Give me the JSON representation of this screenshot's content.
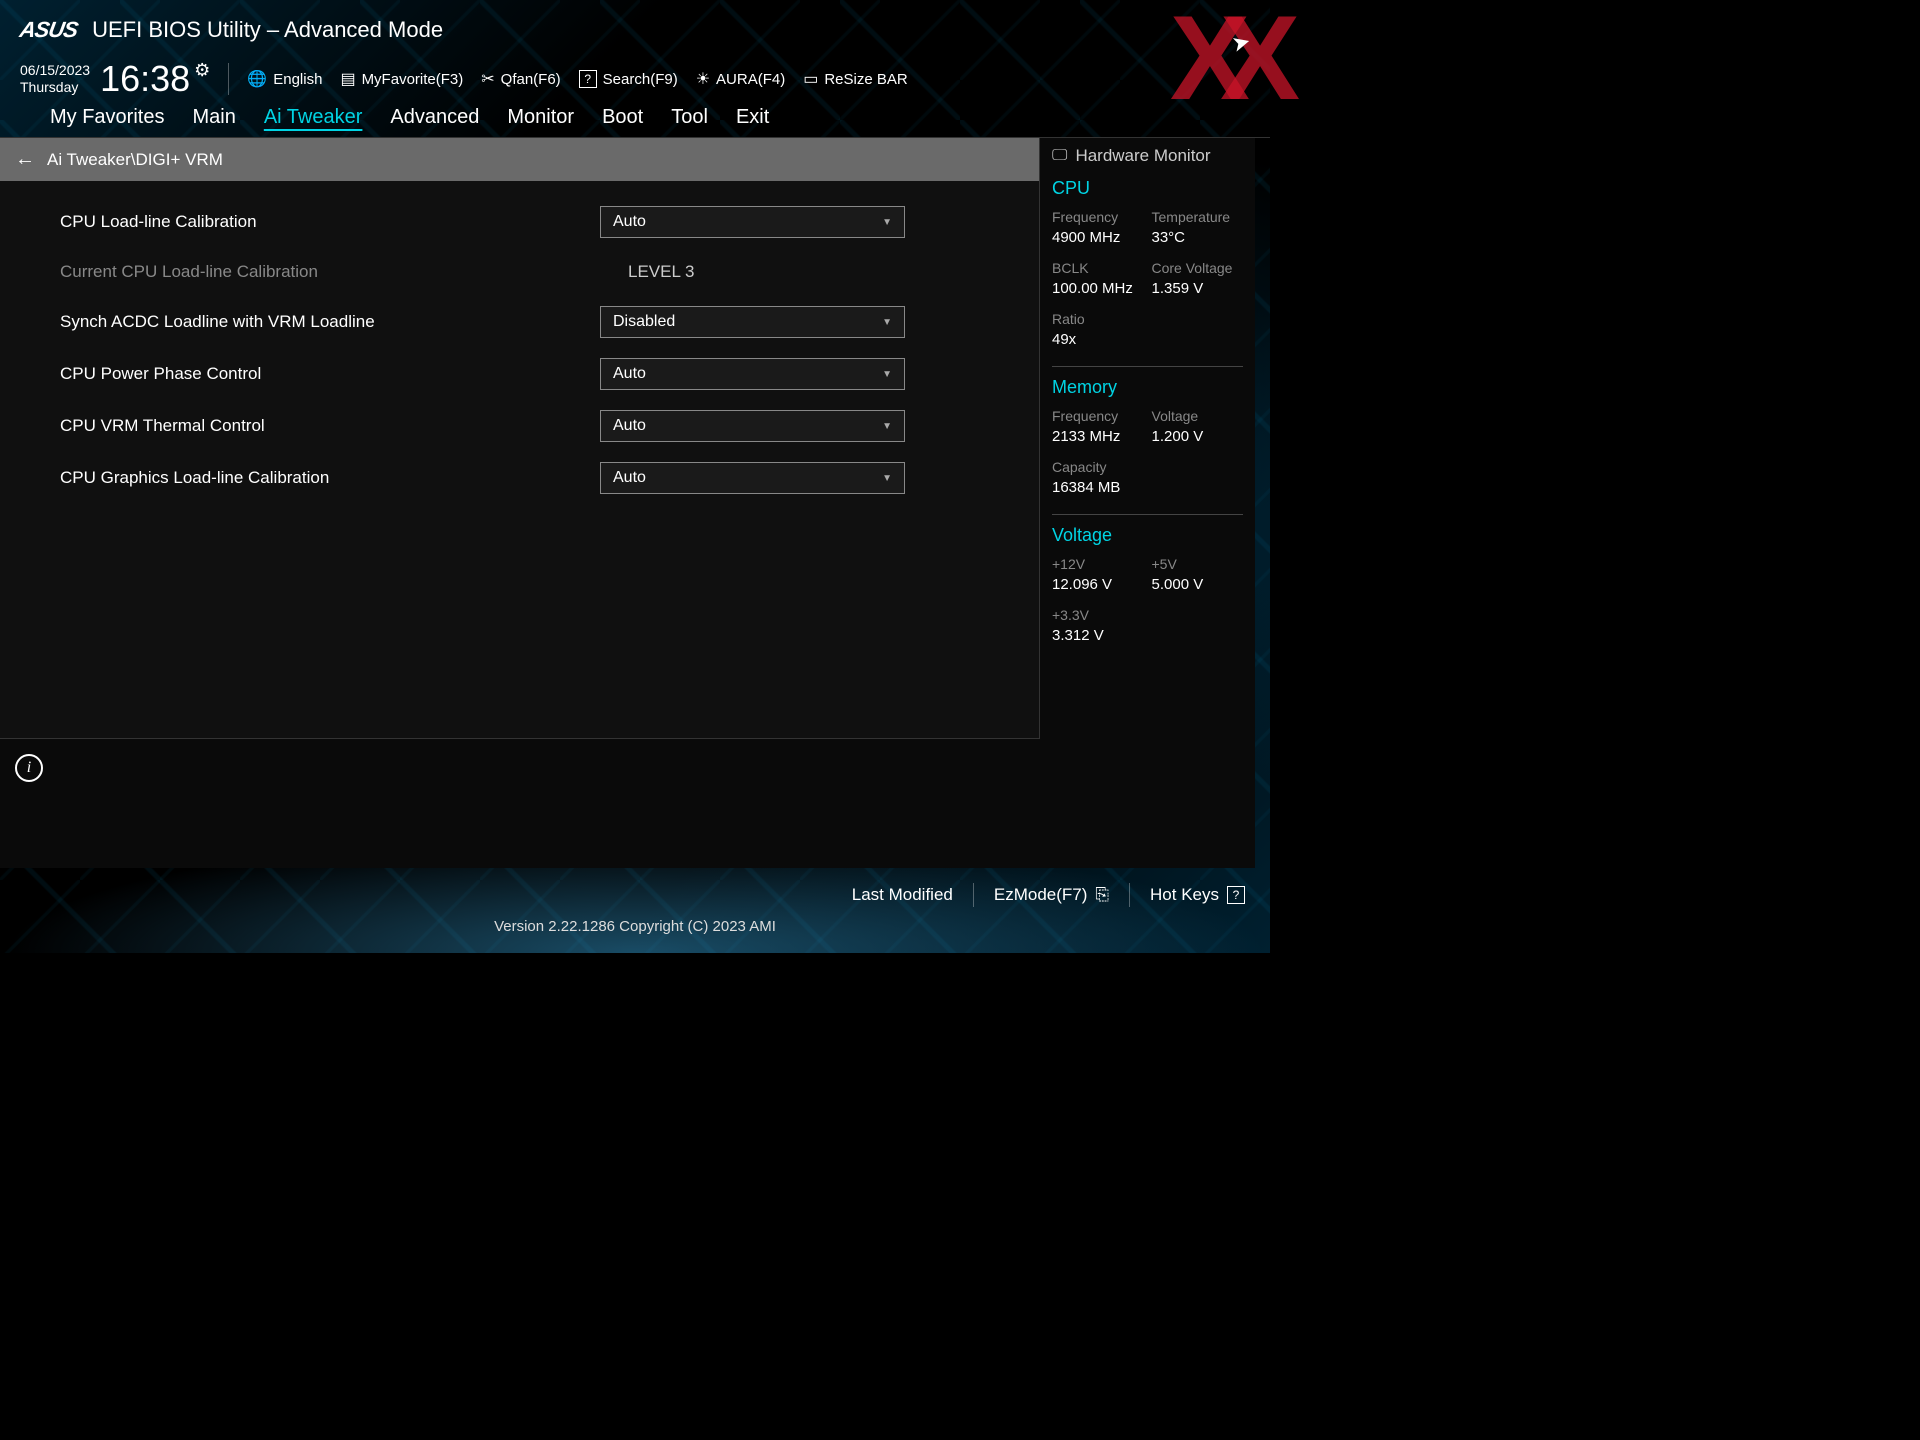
{
  "header": {
    "brand": "ASUS",
    "title": "UEFI BIOS Utility – Advanced Mode",
    "date": "06/15/2023",
    "day": "Thursday",
    "time": "16:38",
    "toolbar": {
      "language": "English",
      "myfavorite": "MyFavorite(F3)",
      "qfan": "Qfan(F6)",
      "search": "Search(F9)",
      "aura": "AURA(F4)",
      "resize_bar": "ReSize BAR"
    }
  },
  "nav": {
    "tabs": [
      "My Favorites",
      "Main",
      "Ai Tweaker",
      "Advanced",
      "Monitor",
      "Boot",
      "Tool",
      "Exit"
    ],
    "active_index": 2
  },
  "breadcrumb": "Ai Tweaker\\DIGI+ VRM",
  "settings": [
    {
      "label": "CPU Load-line Calibration",
      "type": "dropdown",
      "value": "Auto"
    },
    {
      "label": "Current CPU Load-line Calibration",
      "type": "static",
      "value": "LEVEL 3",
      "disabled": true
    },
    {
      "label": "Synch ACDC Loadline with VRM Loadline",
      "type": "dropdown",
      "value": "Disabled"
    },
    {
      "label": "CPU Power Phase Control",
      "type": "dropdown",
      "value": "Auto"
    },
    {
      "label": "CPU VRM Thermal Control",
      "type": "dropdown",
      "value": "Auto"
    },
    {
      "label": "CPU Graphics Load-line Calibration",
      "type": "dropdown",
      "value": "Auto"
    }
  ],
  "sidebar": {
    "title": "Hardware Monitor",
    "cpu": {
      "title": "CPU",
      "frequency": {
        "label": "Frequency",
        "value": "4900 MHz"
      },
      "temperature": {
        "label": "Temperature",
        "value": "33°C"
      },
      "bclk": {
        "label": "BCLK",
        "value": "100.00 MHz"
      },
      "core_voltage": {
        "label": "Core Voltage",
        "value": "1.359 V"
      },
      "ratio": {
        "label": "Ratio",
        "value": "49x"
      }
    },
    "memory": {
      "title": "Memory",
      "frequency": {
        "label": "Frequency",
        "value": "2133 MHz"
      },
      "voltage": {
        "label": "Voltage",
        "value": "1.200 V"
      },
      "capacity": {
        "label": "Capacity",
        "value": "16384 MB"
      }
    },
    "voltage": {
      "title": "Voltage",
      "v12": {
        "label": "+12V",
        "value": "12.096 V"
      },
      "v5": {
        "label": "+5V",
        "value": "5.000 V"
      },
      "v33": {
        "label": "+3.3V",
        "value": "3.312 V"
      }
    }
  },
  "footer": {
    "last_modified": "Last Modified",
    "ezmode": "EzMode(F7)",
    "hotkeys": "Hot Keys",
    "version": "Version 2.22.1286 Copyright (C) 2023 AMI"
  },
  "watermark": "XX"
}
